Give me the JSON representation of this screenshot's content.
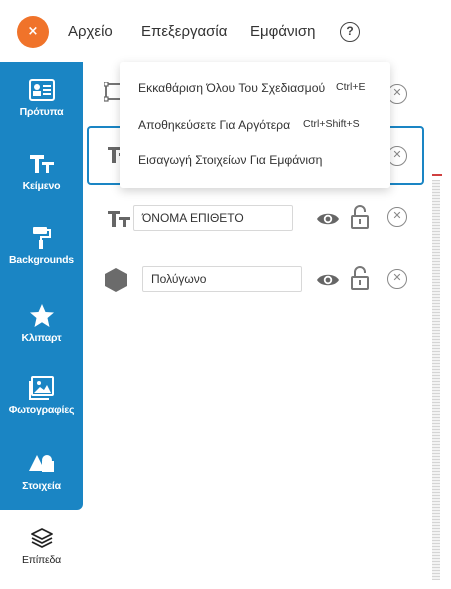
{
  "header": {
    "close_symbol": "×",
    "menu": [
      "Αρχείο",
      "Επεξεργασία",
      "Εμφάνιση"
    ],
    "help_symbol": "?"
  },
  "sidebar": {
    "items": [
      {
        "label": "Πρότυπα",
        "icon": "template-icon"
      },
      {
        "label": "Κείμενο",
        "icon": "text-icon"
      },
      {
        "label": "Backgrounds",
        "icon": "paint-roller-icon"
      },
      {
        "label": "Κλιπαρτ",
        "icon": "star-icon"
      },
      {
        "label": "Φωτογραφίες",
        "icon": "photo-icon"
      },
      {
        "label": "Στοιχεία",
        "icon": "shapes-icon"
      }
    ],
    "active": {
      "label": "Επίπεδα",
      "icon": "layers-icon"
    }
  },
  "dropdown": {
    "items": [
      {
        "label": "Εκκαθάριση Όλου Του Σχεδιασμού",
        "shortcut": "Ctrl+E"
      },
      {
        "label": "Αποθηκεύσετε Για Αργότερα",
        "shortcut": "Ctrl+Shift+S"
      },
      {
        "label": "Εισαγωγή Στοιχείων Για Εμφάνιση",
        "shortcut": ""
      }
    ]
  },
  "layers": [
    {
      "type": "image",
      "name": ""
    },
    {
      "type": "text",
      "name": ""
    },
    {
      "type": "text",
      "name": "ΌΝΟΜΑ ΕΠΙΘΕΤΟ"
    },
    {
      "type": "shape",
      "name": "Πολύγωνο"
    }
  ],
  "colors": {
    "accent": "#1a85c4",
    "close_button": "#f0732a"
  }
}
